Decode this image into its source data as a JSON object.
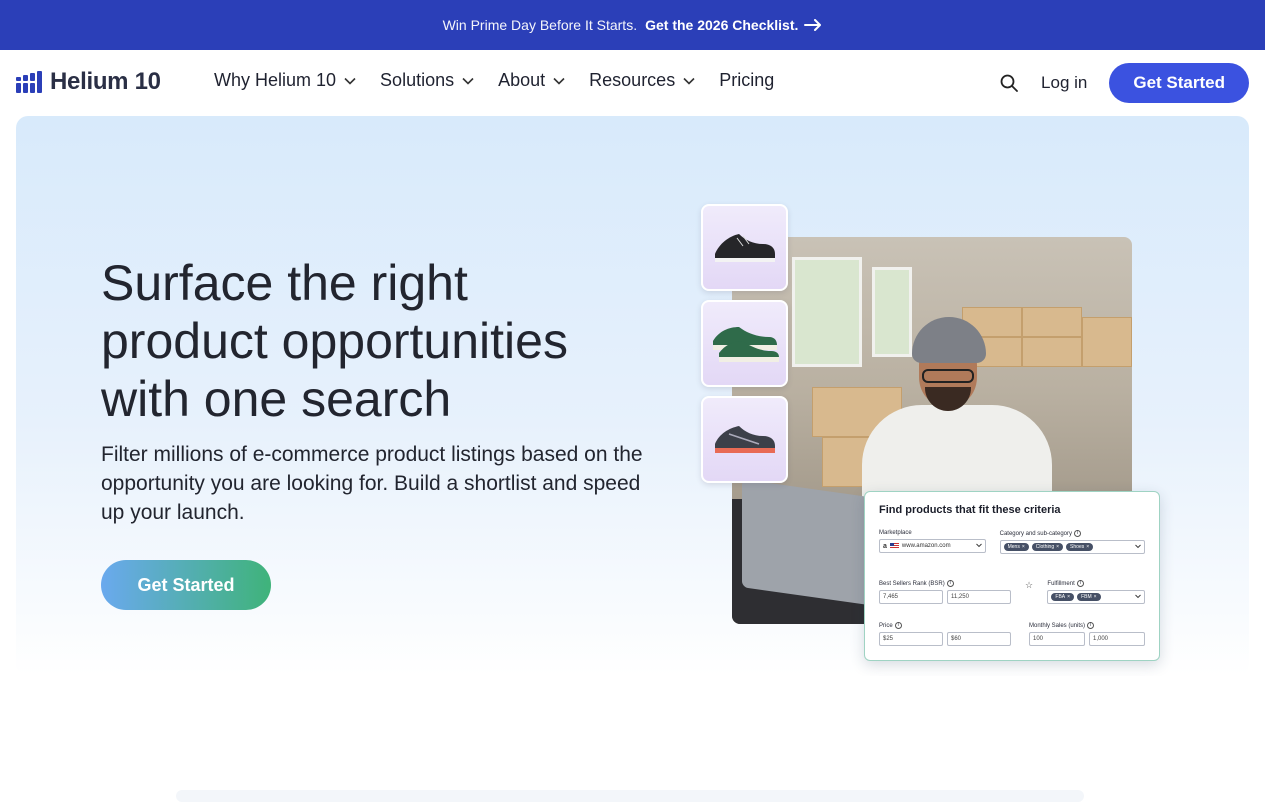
{
  "promo": {
    "lead": "Win Prime Day Before It Starts.",
    "cta": "Get the 2026 Checklist.",
    "arrow_icon": "arrow-right-icon",
    "background": "#2b3fb8"
  },
  "nav": {
    "logo_text": "Helium 10",
    "menu": [
      {
        "label": "Why Helium 10",
        "has_dropdown": true
      },
      {
        "label": "Solutions",
        "has_dropdown": true
      },
      {
        "label": "About",
        "has_dropdown": true
      },
      {
        "label": "Resources",
        "has_dropdown": true
      },
      {
        "label": "Pricing",
        "has_dropdown": false
      }
    ],
    "search_icon": "search-icon",
    "login": "Log in",
    "get_started": "Get Started",
    "accent": "#3b52e0"
  },
  "hero": {
    "headline": "Surface the right product opportunities with one search",
    "subcopy": "Filter millions of e-commerce product listings based on the opportunity you are looking for. Build a shortlist and speed up your launch.",
    "cta": "Get Started"
  },
  "filter_card": {
    "title": "Find products that fit these criteria",
    "marketplace": {
      "label": "Marketplace",
      "value": "www.amazon.com"
    },
    "category": {
      "label": "Category and sub-category",
      "pills": [
        "Mens",
        "Clothing",
        "Shoes"
      ]
    },
    "bsr": {
      "label": "Best Sellers Rank (BSR)",
      "min": "7,465",
      "max": "11,250"
    },
    "fulfillment": {
      "label": "Fulfillment",
      "pills": [
        "FBA",
        "FBM"
      ]
    },
    "price": {
      "label": "Price",
      "min": "$25",
      "max": "$60"
    },
    "monthly_sales": {
      "label": "Monthly Sales (units)",
      "min": "100",
      "max": "1,000"
    }
  }
}
